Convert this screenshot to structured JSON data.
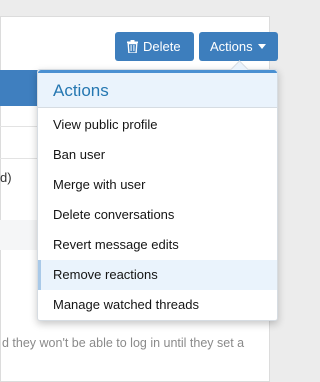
{
  "toolbar": {
    "delete_label": "Delete",
    "actions_label": "Actions"
  },
  "menu": {
    "title": "Actions",
    "items": [
      {
        "label": "View public profile"
      },
      {
        "label": "Ban user"
      },
      {
        "label": "Merge with user"
      },
      {
        "label": "Delete conversations"
      },
      {
        "label": "Revert message edits"
      },
      {
        "label": "Remove reactions"
      },
      {
        "label": "Manage watched threads"
      }
    ]
  },
  "background": {
    "fragment_text": "d)",
    "note_text": "d they won't be able to log in until they set a"
  },
  "colors": {
    "accent": "#3d7ebd",
    "menu_header_bg": "#eaf3fc",
    "menu_title": "#2577b1"
  }
}
